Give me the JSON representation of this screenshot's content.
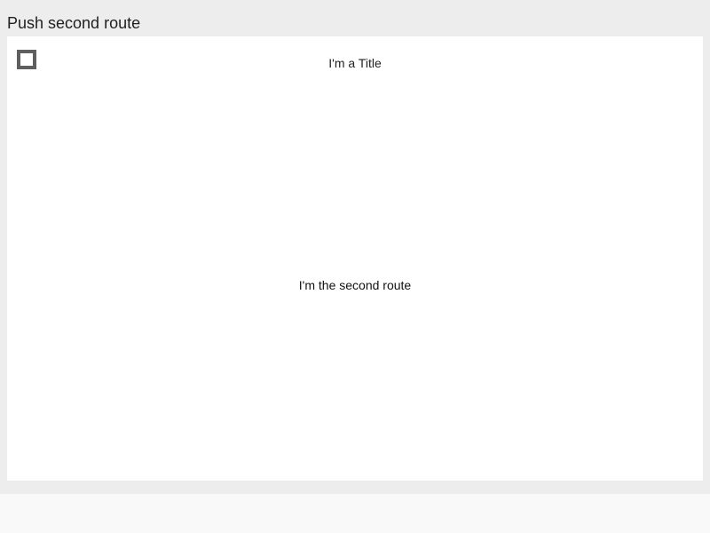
{
  "window": {
    "title": "Push second route"
  },
  "navigation_bar": {
    "title": "I'm a Title",
    "back_icon": "square-outline-icon"
  },
  "content": {
    "text": "I'm the second route"
  },
  "colors": {
    "frame_background": "#ededed",
    "panel_background": "#ffffff",
    "icon_border": "#5f5f5f"
  }
}
